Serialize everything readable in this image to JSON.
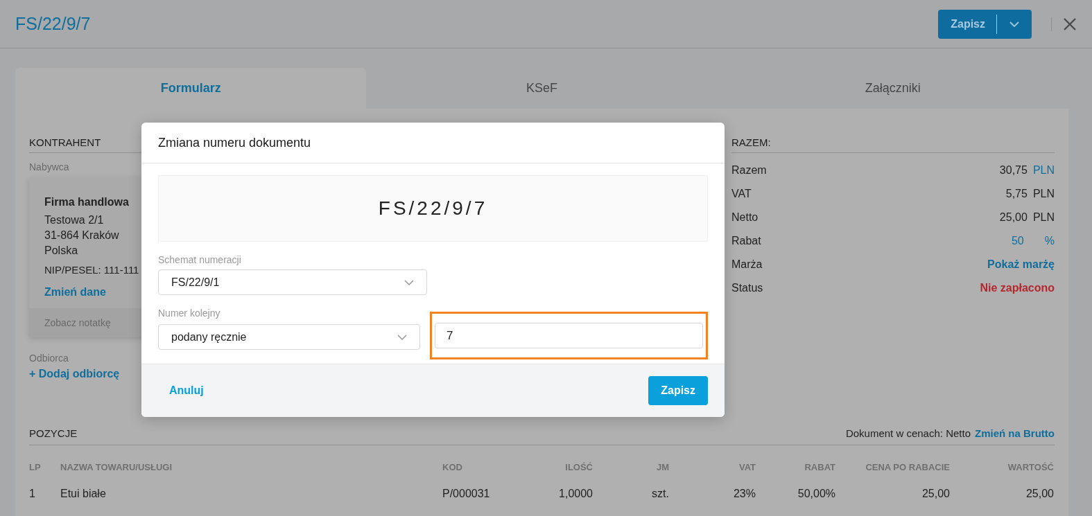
{
  "header": {
    "title": "FS/22/9/7",
    "save_button": "Zapisz"
  },
  "tabs": [
    {
      "label": "Formularz",
      "selected": true
    },
    {
      "label": "KSeF",
      "selected": false
    },
    {
      "label": "Załączniki",
      "selected": false
    }
  ],
  "contractor": {
    "heading": "KONTRAHENT",
    "buyer_label": "Nabywca",
    "name": "Firma handlowa",
    "address": [
      "Testowa 2/1",
      "31-864 Kraków",
      "Polska"
    ],
    "tax_id": "NIP/PESEL: 111-111",
    "edit_link": "Zmień dane",
    "note_link": "Zobacz notatkę",
    "recipient_label": "Odbiorca",
    "add_recipient": "+ Dodaj odbiorcę"
  },
  "totals": {
    "heading": "RAZEM:",
    "rows": [
      {
        "kind": "amount",
        "label": "Razem",
        "value": "30,75",
        "unit": "PLN",
        "unit_link": true
      },
      {
        "kind": "amount",
        "label": "VAT",
        "value": "5,75",
        "unit": "PLN",
        "unit_link": false
      },
      {
        "kind": "amount",
        "label": "Netto",
        "value": "25,00",
        "unit": "PLN",
        "unit_link": false
      },
      {
        "kind": "discount",
        "label": "Rabat",
        "value": "50",
        "unit": "%"
      },
      {
        "kind": "link",
        "label": "Marża",
        "value": "Pokaż marżę"
      },
      {
        "kind": "status",
        "label": "Status",
        "value": "Nie zapłacono"
      }
    ]
  },
  "positions": {
    "heading": "POZYCJE",
    "price_mode": "Dokument w cenach: Netto",
    "price_mode_link": "Zmień na Brutto",
    "columns": [
      "LP",
      "NAZWA TOWARU/USŁUGI",
      "KOD",
      "ILOŚĆ",
      "JM",
      "VAT",
      "RABAT",
      "CENA PO RABACIE",
      "WARTOŚĆ"
    ],
    "rows": [
      [
        "1",
        "Etui białe",
        "P/000031",
        "1,0000",
        "szt.",
        "23%",
        "50,00%",
        "25,00",
        "25,00"
      ]
    ]
  },
  "dialog": {
    "title": "Zmiana numeru dokumentu",
    "preview": "FS/22/9/7",
    "scheme_label": "Schemat numeracji",
    "scheme_value": "FS/22/9/1",
    "sequence_label": "Numer kolejny",
    "sequence_value": "podany ręcznie",
    "number_field": {
      "value": "7",
      "highlighted": true
    },
    "cancel": "Anuluj",
    "save": "Zapisz"
  }
}
